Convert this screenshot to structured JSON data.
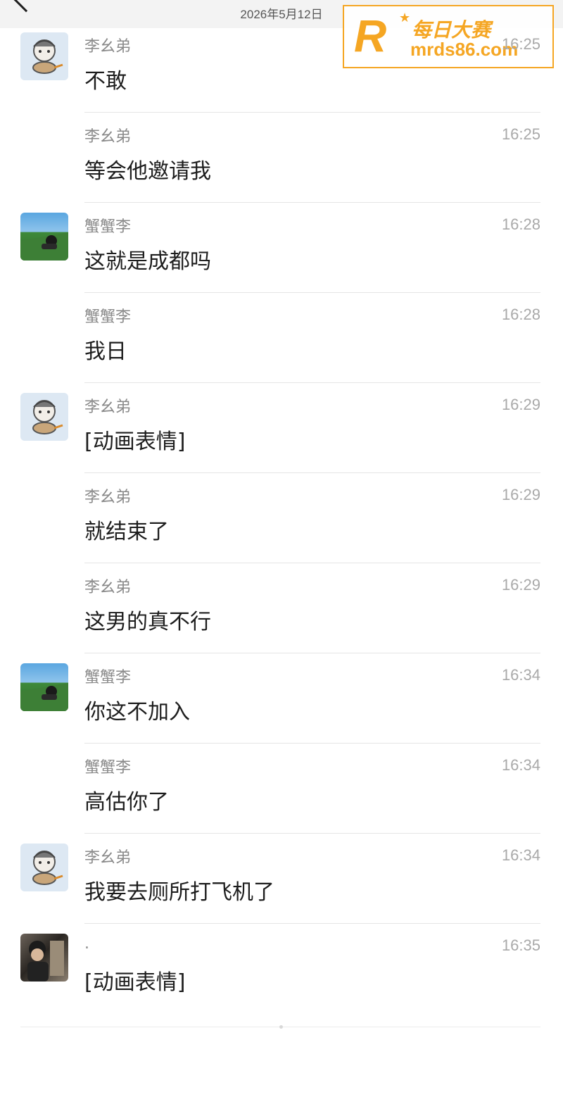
{
  "header": {
    "date": "2026年5月12日"
  },
  "watermark": {
    "logo_letter": "R",
    "title": "每日大赛",
    "url": "mrds86.com",
    "color": "#f5a623"
  },
  "messages": [
    {
      "sender": "李幺弟",
      "time": "16:25",
      "text": "不敢",
      "avatar": "li-yao-di"
    },
    {
      "sender": "李幺弟",
      "time": "16:25",
      "text": "等会他邀请我",
      "avatar": ""
    },
    {
      "sender": "蟹蟹李",
      "time": "16:28",
      "text": "这就是成都吗",
      "avatar": "xie-xie-li"
    },
    {
      "sender": "蟹蟹李",
      "time": "16:28",
      "text": "我日",
      "avatar": ""
    },
    {
      "sender": "李幺弟",
      "time": "16:29",
      "text": "[动画表情]",
      "avatar": "li-yao-di"
    },
    {
      "sender": "李幺弟",
      "time": "16:29",
      "text": "就结束了",
      "avatar": ""
    },
    {
      "sender": "李幺弟",
      "time": "16:29",
      "text": "这男的真不行",
      "avatar": ""
    },
    {
      "sender": "蟹蟹李",
      "time": "16:34",
      "text": "你这不加入",
      "avatar": "xie-xie-li"
    },
    {
      "sender": "蟹蟹李",
      "time": "16:34",
      "text": "高估你了",
      "avatar": ""
    },
    {
      "sender": "李幺弟",
      "time": "16:34",
      "text": "我要去厕所打飞机了",
      "avatar": "li-yao-di"
    },
    {
      "sender": ".",
      "time": "16:35",
      "text": "[动画表情]",
      "avatar": "dot-user"
    }
  ]
}
